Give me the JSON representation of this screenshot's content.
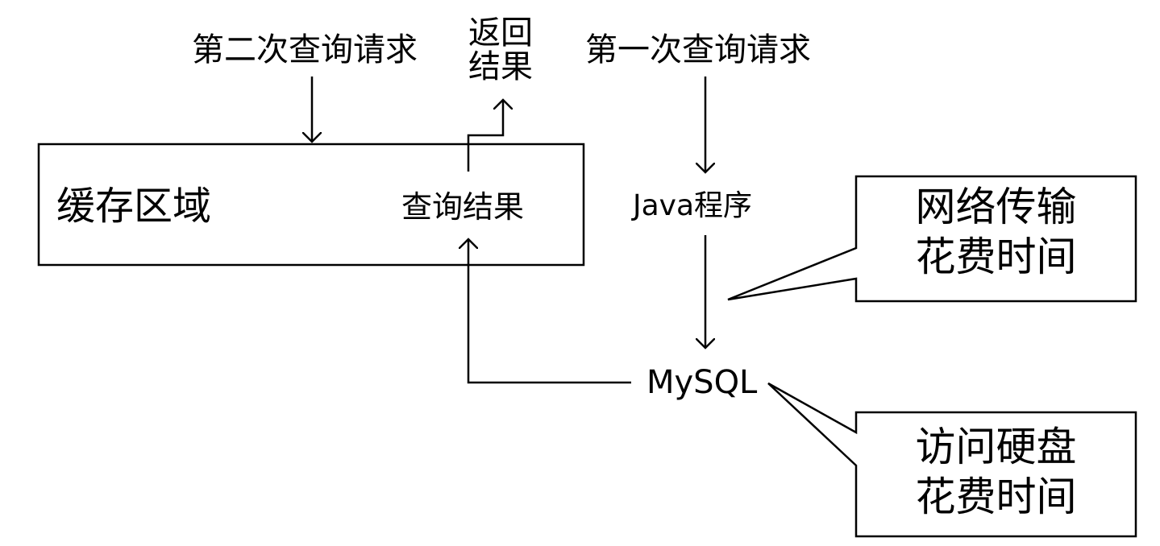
{
  "diagram": {
    "second_query": "第二次查询请求",
    "return_result": [
      "返回",
      "结果"
    ],
    "first_query": "第一次查询请求",
    "cache_area": "缓存区域",
    "query_result": "查询结果",
    "java_program": "Java程序",
    "mysql": "MySQL",
    "callout_network": [
      "网络传输",
      "花费时间"
    ],
    "callout_disk": [
      "访问硬盘",
      "花费时间"
    ]
  },
  "colors": {
    "stroke": "#000000",
    "background": "#ffffff"
  }
}
